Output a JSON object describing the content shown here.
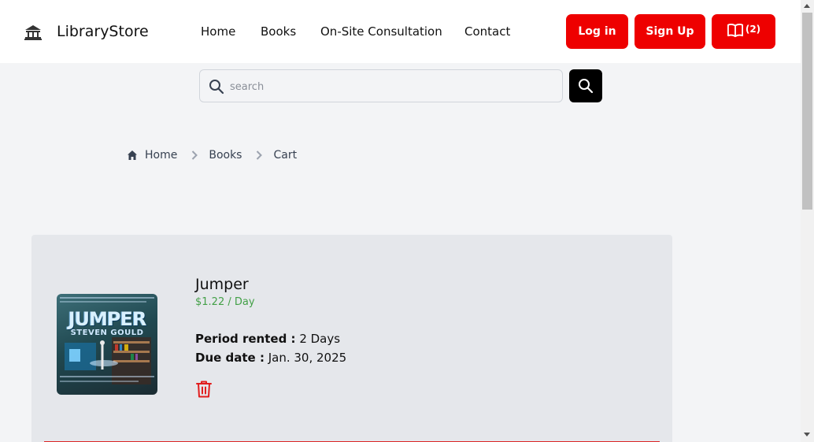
{
  "header": {
    "brand": "LibraryStore",
    "logo_icon": "library-building-icon",
    "nav": [
      {
        "label": "Home"
      },
      {
        "label": "Books"
      },
      {
        "label": "On-Site Consultation"
      },
      {
        "label": "Contact"
      }
    ],
    "login_label": "Log in",
    "signup_label": "Sign Up",
    "cart": {
      "icon": "open-book-icon",
      "count": "(2)"
    }
  },
  "search": {
    "placeholder": "search",
    "value": ""
  },
  "breadcrumb": [
    {
      "label": "Home",
      "icon": "home-icon"
    },
    {
      "label": "Books"
    },
    {
      "label": "Cart"
    }
  ],
  "cart_item": {
    "title": "Jumper",
    "price": "$1.22 / Day",
    "period_label": "Period rented :",
    "period_value": "2 Days",
    "due_label": "Due date :",
    "due_value": "Jan. 30, 2025",
    "cover_title": "JUMPER",
    "cover_author": "STEVEN GOULD"
  },
  "colors": {
    "accent_red": "#ee0000",
    "price_green": "#43a047",
    "card_bg": "#e5e7eb"
  }
}
